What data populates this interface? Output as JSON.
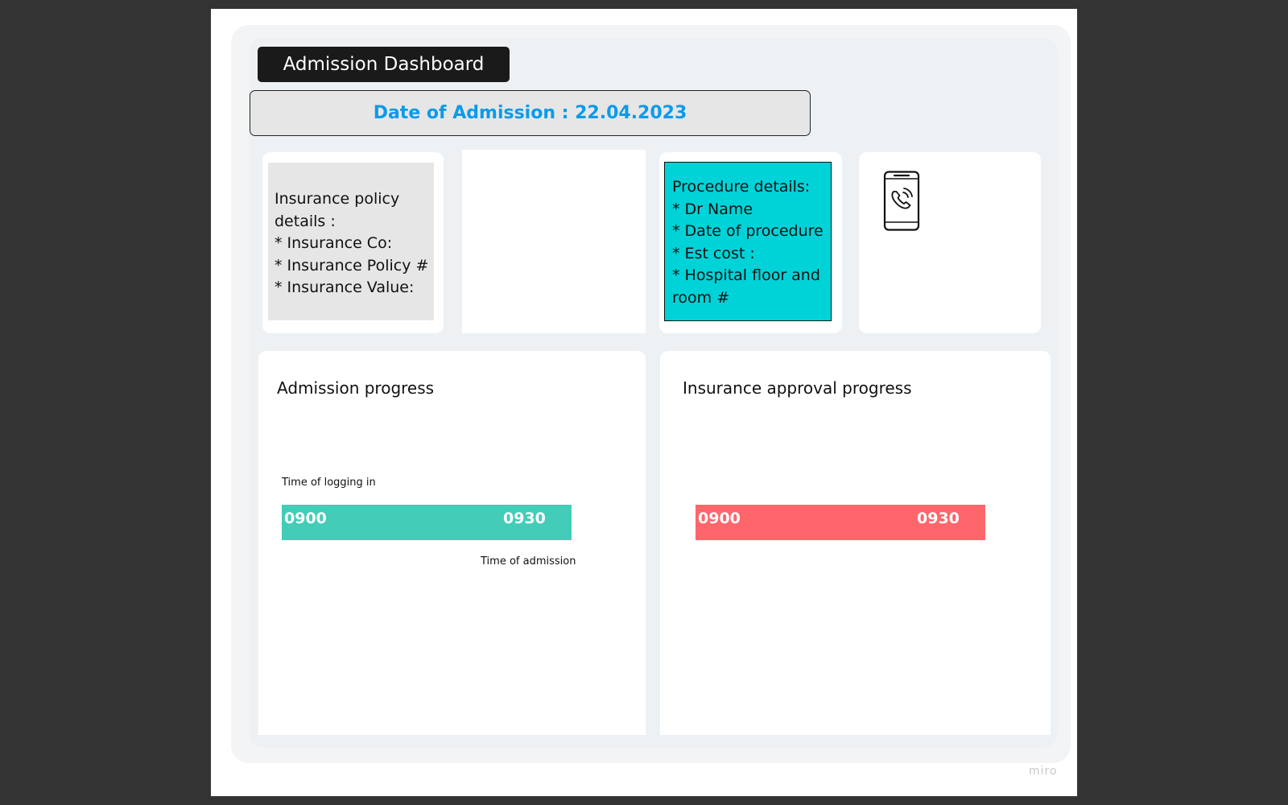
{
  "dashboard": {
    "title": "Admission Dashboard",
    "date_label": "Date of Admission : 22.04.2023"
  },
  "insurance_card": {
    "lines": [
      "Insurance policy",
      "details :",
      "* Insurance Co:",
      "* Insurance Policy #",
      "* Insurance Value:"
    ]
  },
  "procedure_card": {
    "lines": [
      "Procedure details:",
      "* Dr Name",
      "* Date of procedure",
      "* Est cost :",
      "* Hospital floor and room #"
    ]
  },
  "contact_card": {
    "icon": "phone-call-icon"
  },
  "admission_progress": {
    "title": "Admission progress",
    "top_label": "Time of logging in",
    "start": "0900",
    "end": "0930",
    "bottom_label": "Time of admission",
    "color": "#43cdb8"
  },
  "insurance_progress": {
    "title": "Insurance approval progress",
    "start": "0900",
    "end": "0930",
    "color": "#ff666b"
  },
  "watermark": "miro",
  "colors": {
    "accent_blue": "#0b9be8",
    "procedure_bg": "#00d3d8",
    "title_bg": "#1a1a1a"
  }
}
